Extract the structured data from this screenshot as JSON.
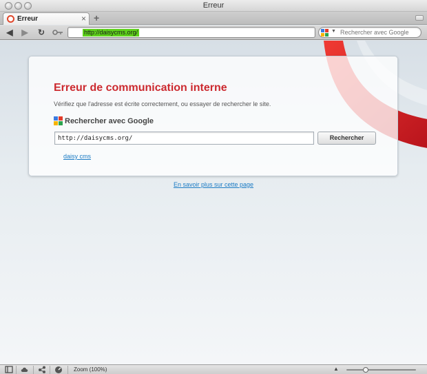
{
  "window": {
    "title": "Erreur"
  },
  "tab": {
    "title": "Erreur",
    "close": "×",
    "new_tab": "+"
  },
  "address_bar": {
    "url": "http://daisycms.org/"
  },
  "search_bar": {
    "placeholder": "Rechercher avec Google",
    "engine_icon": "google-icon"
  },
  "toolbar_icons": [
    "back-arrow-icon",
    "forward-arrow-icon",
    "reload-icon",
    "key-icon"
  ],
  "error": {
    "title": "Erreur de communication interne",
    "description": "Vérifiez que l'adresse est écrite correctement, ou essayer de rechercher le site.",
    "search_heading": "Rechercher avec Google",
    "query_value": "http://daisycms.org/",
    "search_button": "Rechercher",
    "suggestion": "daisy cms"
  },
  "learn_more": "En savoir plus sur cette page",
  "status_bar": {
    "zoom_label": "Zoom (100%)",
    "zoom_level": 1.0,
    "zoom_slider_fraction": 0.28,
    "icons": [
      "panel-icon",
      "cloud-icon",
      "share-icon",
      "speed-dial-icon"
    ]
  },
  "colors": {
    "error_title": "#cc2a2f",
    "link": "#1b7bc4",
    "url_highlight": "#5ed11b",
    "brand_red": "#e0171f"
  }
}
